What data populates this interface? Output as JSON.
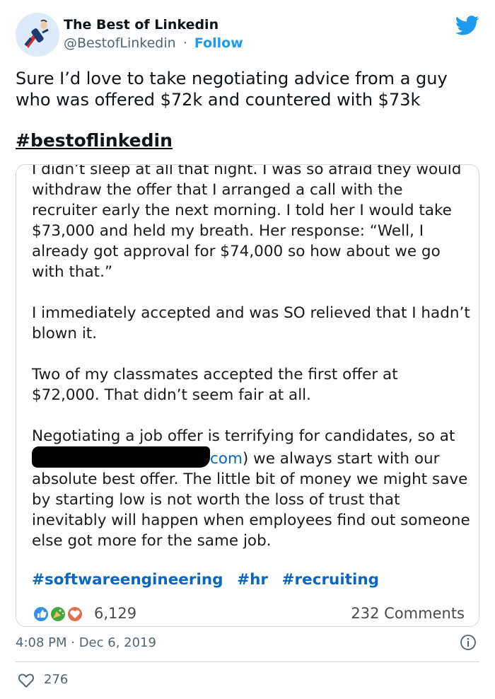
{
  "account": {
    "name": "The Best of Linkedin",
    "handle": "@BestofLinkedin",
    "separator": "·",
    "follow_label": "Follow"
  },
  "tweet": {
    "text": "Sure I’d love to take negotiating advice from a guy who was offered $72k and countered with $73k",
    "hashtag": "#bestoflinkedin"
  },
  "embedded_post": {
    "p1": "I didn’t sleep at all that night. I was so afraid they would withdraw the offer that I arranged a call with the recruiter early the next morning. I told her I would take $73,000 and held my breath. Her response: “Well, I already got approval for $74,000 so how about we go with that.”",
    "p2": "I immediately accepted and was SO relieved that I hadn’t blown it.",
    "p3": "Two of my classmates accepted the first offer at $72,000. That didn’t seem fair at all.",
    "p4_start": "Negotiating a job offer is terrifying for candidates, so at",
    "p4_link_tail": "com",
    "p4_end": ") we always start with our absolute best offer. The little bit of money we might save by starting low is not worth the loss of trust that inevitably will happen when employees find out someone else got more for the same job.",
    "tags": [
      "#softwareengineering",
      "#hr",
      "#recruiting"
    ],
    "reaction_count": "6,129",
    "comments": "232 Comments"
  },
  "footer": {
    "timestamp": "4:08 PM · Dec 6, 2019",
    "like_count": "276"
  },
  "colors": {
    "twitter_blue": "#1d9bf0",
    "linkedin_blue": "#0a66c2",
    "text": "#0f1419",
    "muted": "#536471"
  },
  "icons": {
    "avatar": "superhero-avatar",
    "brand": "twitter-bird-icon",
    "info": "info-icon",
    "like": "heart-icon",
    "reactions": [
      "like-reaction-icon",
      "celebrate-reaction-icon",
      "love-reaction-icon"
    ]
  }
}
